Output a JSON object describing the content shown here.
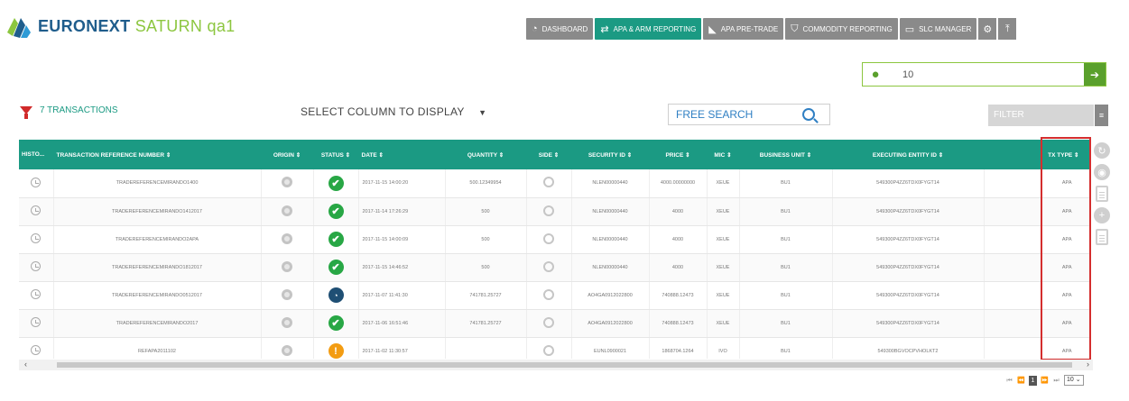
{
  "app": {
    "brand_main": "EURONEXT",
    "brand_sub": "SATURN qa1"
  },
  "nav": {
    "items": [
      {
        "label": "DASHBOARD",
        "icon": "dashboard-icon"
      },
      {
        "label": "APA & ARM REPORTING",
        "icon": "arrows-exchange-icon",
        "active": true
      },
      {
        "label": "APA PRE-TRADE",
        "icon": "rss-icon"
      },
      {
        "label": "COMMODITY REPORTING",
        "icon": "shield-icon"
      },
      {
        "label": "SLC MANAGER",
        "icon": "card-icon"
      }
    ],
    "settings_icon": "gear-icon",
    "upload_icon": "upload-icon"
  },
  "user": {
    "value": "10",
    "icon": "user-icon",
    "logout_icon": "logout-icon"
  },
  "toolbar": {
    "count_label": "7 TRANSACTIONS",
    "select_columns": "SELECT COLUMN TO DISPLAY",
    "search_placeholder": "FREE SEARCH",
    "filter_placeholder": "FILTER"
  },
  "table": {
    "columns": [
      "HISTO...",
      "TRANSACTION REFERENCE NUMBER ⇕",
      "ORIGIN ⇕",
      "STATUS ⇕",
      "DATE ⇕",
      "QUANTITY ⇕",
      "SIDE ⇕",
      "SECURITY ID ⇕",
      "PRICE ⇕",
      "MIC ⇕",
      "BUSINESS UNIT ⇕",
      "EXECUTING ENTITY ID ⇕",
      "TX TYPE ⇕"
    ],
    "rows": [
      {
        "ref": "TRADEREFERENCEMIRANDO1400",
        "status": "ok",
        "date": "2017-11-15 14:00:20",
        "qty": "500.12349954",
        "sec": "NLEN00000440",
        "price": "4000.00000000",
        "mic": "XEUE",
        "bu": "BU1",
        "entity": "549300P4ZZ6TDX0FYGT14",
        "tx": "APA"
      },
      {
        "ref": "TRADEREFERENCEMIRANDO1412017",
        "status": "ok",
        "date": "2017-11-14 17:26:29",
        "qty": "500",
        "sec": "NLEN00000440",
        "price": "4000",
        "mic": "XEUE",
        "bu": "BU1",
        "entity": "549300P4ZZ6TDX0FYGT14",
        "tx": "APA"
      },
      {
        "ref": "TRADEREFERENCEMIRANDO2APA",
        "status": "ok",
        "date": "2017-11-15 14:00:09",
        "qty": "500",
        "sec": "NLEN00000440",
        "price": "4000",
        "mic": "XEUE",
        "bu": "BU1",
        "entity": "549300P4ZZ6TDX0FYGT14",
        "tx": "APA"
      },
      {
        "ref": "TRADEREFERENCEMIRANDO1812017",
        "status": "ok",
        "date": "2017-11-15 14:46:52",
        "qty": "500",
        "sec": "NLEN00000440",
        "price": "4000",
        "mic": "XEUE",
        "bu": "BU1",
        "entity": "549300P4ZZ6TDX0FYGT14",
        "tx": "APA"
      },
      {
        "ref": "TRADEREFERENCEMIRANDO0512017",
        "status": "pending",
        "date": "2017-11-07 11:41:30",
        "qty": "741781.25727",
        "sec": "AO4GA0912022800",
        "price": "740888.12473",
        "mic": "XEUE",
        "bu": "BU1",
        "entity": "549300P4ZZ6TDX0FYGT14",
        "tx": "APA"
      },
      {
        "ref": "TRADEREFERENCEMIRANDO2017",
        "status": "ok",
        "date": "2017-11-06 16:51:46",
        "qty": "741781.25727",
        "sec": "AO4GA0912022800",
        "price": "740888.12473",
        "mic": "XEUE",
        "bu": "BU1",
        "entity": "549300P4ZZ6TDX0FYGT14",
        "tx": "APA"
      },
      {
        "ref": "REFAPA2011102",
        "status": "warn",
        "date": "2017-11-02 11:30:57",
        "qty": "",
        "sec": "EUNL0900021",
        "price": "1868704.1264",
        "mic": "IVO",
        "bu": "BU1",
        "entity": "549300BGVOCPVHOLKT2",
        "tx": "APA"
      }
    ]
  },
  "pager": {
    "first": "⏮",
    "prev": "⏪",
    "current": "1",
    "next": "⏩",
    "last": "⏭",
    "page_size": "10"
  },
  "side_tools": [
    "refresh-icon",
    "eye-icon",
    "export-excel-icon",
    "add-icon",
    "document-icon"
  ],
  "colors": {
    "accent": "#1b9a83",
    "brand": "#1f5d8c",
    "highlight": "#d42e2e",
    "ok": "#28a745",
    "warn": "#f39c12"
  }
}
